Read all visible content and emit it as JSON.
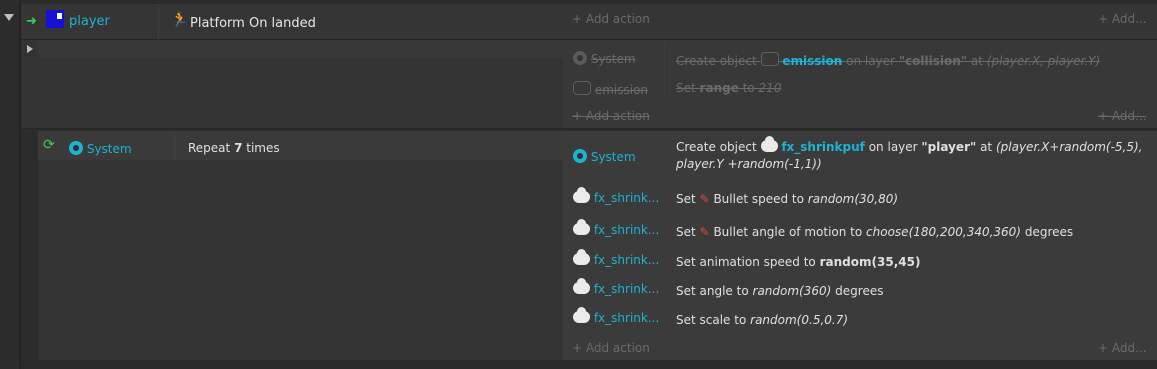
{
  "event": {
    "object_name": "player",
    "condition_text": "Platform On landed",
    "add_action": "+ Add action",
    "add_more": "+ Add..."
  },
  "sub_event_1": {
    "actions": [
      {
        "object": "System",
        "icon": "gear-icon",
        "prefix": "Create object",
        "object_ref": "emission",
        "mid": "on layer",
        "layer": "\"collision\"",
        "suffix": "at",
        "coords": "(player.X, player.Y)"
      },
      {
        "object": "emission",
        "icon": "emitter-icon",
        "prefix": "Set",
        "param": "range",
        "suffix": "to",
        "value": "210"
      }
    ],
    "add_action": "+ Add action",
    "add_more": "+ Add..."
  },
  "sub_event_2": {
    "condition_object": "System",
    "condition_text_prefix": "Repeat",
    "condition_count": "7",
    "condition_text_suffix": "times",
    "actions": [
      {
        "object": "System",
        "line1_prefix": "Create object",
        "object_ref": "fx_shrinkpuf",
        "line1_mid": "on layer",
        "layer": "\"player\"",
        "line1_at": "at",
        "line1_expr": "(player.X+random(-5,5),",
        "line2_expr": "player.Y +random(-1,1))"
      },
      {
        "object": "fx_shrink...",
        "prefix": "Set",
        "behavior": "Bullet speed to",
        "expr": "random(30,80)",
        "suffix": ""
      },
      {
        "object": "fx_shrink...",
        "prefix": "Set",
        "behavior": "Bullet angle of motion to",
        "expr": "choose(180,200,340,360)",
        "suffix": "degrees"
      },
      {
        "object": "fx_shrink...",
        "prefix": "Set animation speed to",
        "expr": "random(35,45)",
        "suffix": ""
      },
      {
        "object": "fx_shrink...",
        "prefix": "Set angle to",
        "expr": "random(360)",
        "suffix": "degrees"
      },
      {
        "object": "fx_shrink...",
        "prefix": "Set scale to",
        "expr": "random(0.5,0.7)",
        "suffix": ""
      }
    ],
    "add_action": "+ Add action",
    "add_more": "+ Add..."
  }
}
